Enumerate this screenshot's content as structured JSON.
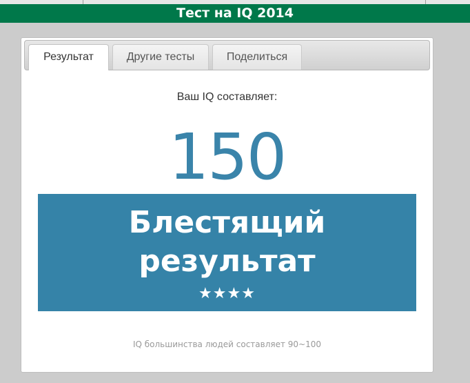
{
  "header": {
    "title": "Тест на IQ 2014"
  },
  "tabs": [
    {
      "label": "Результат",
      "active": true
    },
    {
      "label": "Другие тесты",
      "active": false
    },
    {
      "label": "Поделиться",
      "active": false
    }
  ],
  "result": {
    "label": "Ваш IQ составляет:",
    "iq": "150",
    "title_line1": "Блестящий",
    "title_line2": "результат",
    "rating": 4,
    "stars": "★★★★",
    "footnote": "IQ большинства людей составляет 90~100"
  },
  "colors": {
    "header_bg": "#00784a",
    "accent": "#3583a8",
    "iq_text": "#3a84aa",
    "page_bg": "#cccccc"
  }
}
